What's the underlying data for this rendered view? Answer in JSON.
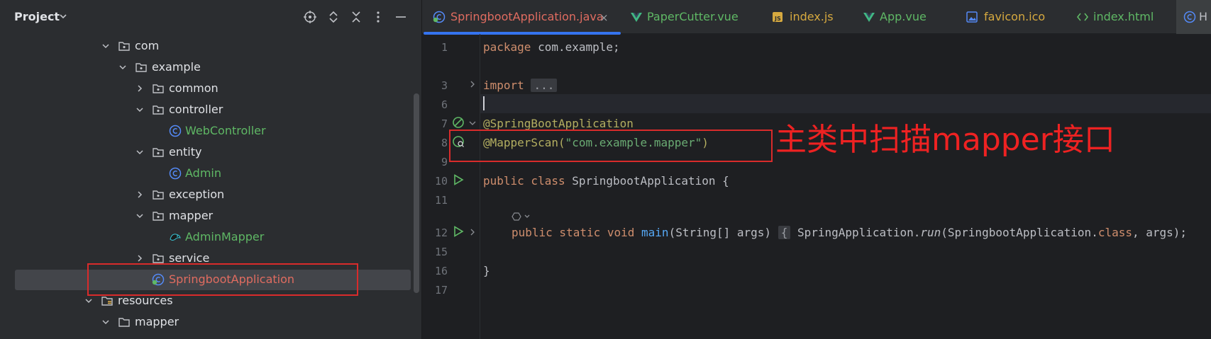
{
  "project_panel": {
    "title": "Project",
    "header_icons": [
      "locate-icon",
      "expand-all-icon",
      "collapse-all-icon",
      "more-options-icon",
      "minimize-icon"
    ],
    "tree": [
      {
        "label": "com",
        "type": "package",
        "expanded": true
      },
      {
        "label": "example",
        "type": "package",
        "expanded": true
      },
      {
        "label": "common",
        "type": "package",
        "expanded": false
      },
      {
        "label": "controller",
        "type": "package",
        "expanded": true
      },
      {
        "label": "WebController",
        "type": "class"
      },
      {
        "label": "entity",
        "type": "package",
        "expanded": true
      },
      {
        "label": "Admin",
        "type": "class"
      },
      {
        "label": "exception",
        "type": "package",
        "expanded": false
      },
      {
        "label": "mapper",
        "type": "package",
        "expanded": true
      },
      {
        "label": "AdminMapper",
        "type": "mapper-interface"
      },
      {
        "label": "service",
        "type": "package",
        "expanded": false
      },
      {
        "label": "SpringbootApplication",
        "type": "spring-class",
        "selected": true
      },
      {
        "label": "resources",
        "type": "resources-folder",
        "expanded": true
      },
      {
        "label": "mapper",
        "type": "folder",
        "expanded": true
      }
    ]
  },
  "tabs": [
    {
      "label": "SpringbootApplication.java",
      "icon": "spring-class-icon",
      "active": true,
      "close": "×"
    },
    {
      "label": "PaperCutter.vue",
      "icon": "vue-icon"
    },
    {
      "label": "index.js",
      "icon": "js-icon"
    },
    {
      "label": "App.vue",
      "icon": "vue-icon"
    },
    {
      "label": "favicon.ico",
      "icon": "image-icon"
    },
    {
      "label": "index.html",
      "icon": "html-icon"
    },
    {
      "label": "H",
      "icon": "class-icon"
    }
  ],
  "editor": {
    "line_numbers": [
      "1",
      "3",
      "6",
      "7",
      "8",
      "9",
      "10",
      "11",
      "12",
      "15",
      "16",
      "17"
    ],
    "lines": {
      "l1_kw": "package",
      "l1_rest": " com.example;",
      "l3_kw": "import",
      "l3_fold": "...",
      "l7_ann": "@SpringBootApplication",
      "l8_ann": "@MapperScan(",
      "l8_str": "\"com.example.mapper\"",
      "l8_close": ")",
      "l10_kw": "public class",
      "l10_rest": " SpringbootApplication {",
      "l12_kw": "public static void",
      "l12_fn": " main",
      "l12_args": "(String[] args) ",
      "l12_brace_open": "{",
      "l12_call": " SpringApplication.",
      "l12_run": "run",
      "l12_call2": "(SpringbootApplication.",
      "l12_class_kw": "class",
      "l12_tail": ", args);",
      "l16": "}"
    }
  },
  "annotation": {
    "callout": "主类中扫描mapper接口",
    "color": "#ee2222"
  }
}
